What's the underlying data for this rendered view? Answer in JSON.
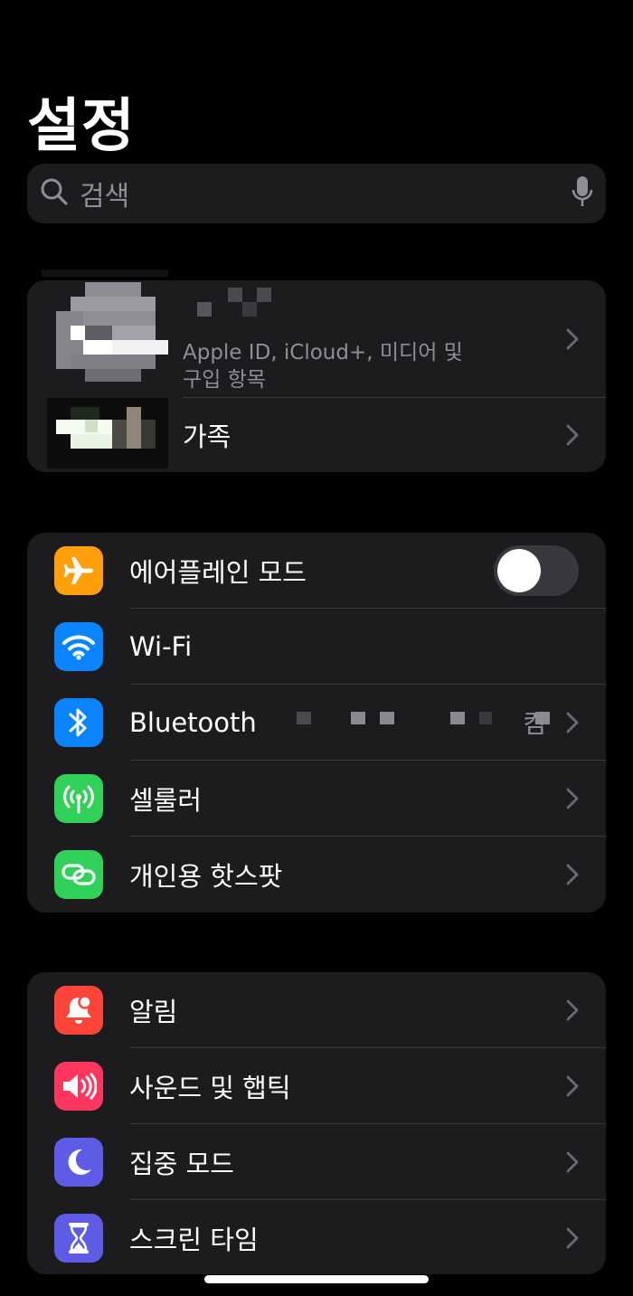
{
  "title": "설정",
  "search": {
    "placeholder": "검색",
    "icon": "search-icon",
    "mic_icon": "microphone-icon"
  },
  "account": {
    "name": "",
    "subtitle_line1": "Apple ID, iCloud+, 미디어 및",
    "subtitle_line2": "구입 항목",
    "family_label": "가족"
  },
  "connectivity": [
    {
      "key": "airplane",
      "label": "에어플레인 모드",
      "icon": "airplane-icon",
      "color": "#ff9f0a",
      "toggle": false
    },
    {
      "key": "wifi",
      "label": "Wi-Fi",
      "icon": "wifi-icon",
      "color": "#0a84ff",
      "value": ""
    },
    {
      "key": "bluetooth",
      "label": "Bluetooth",
      "icon": "bluetooth-icon",
      "color": "#0a84ff",
      "value": "켬"
    },
    {
      "key": "cellular",
      "label": "셀룰러",
      "icon": "cellular-antenna-icon",
      "color": "#30d158"
    },
    {
      "key": "hotspot",
      "label": "개인용 핫스팟",
      "icon": "hotspot-link-icon",
      "color": "#30d158"
    }
  ],
  "general": [
    {
      "key": "notifications",
      "label": "알림",
      "icon": "bell-icon",
      "color": "#ff453a"
    },
    {
      "key": "sounds",
      "label": "사운드 및 햅틱",
      "icon": "speaker-icon",
      "color": "#ff375f"
    },
    {
      "key": "focus",
      "label": "집중 모드",
      "icon": "moon-icon",
      "color": "#5e5ce6"
    },
    {
      "key": "screentime",
      "label": "스크린 타임",
      "icon": "hourglass-icon",
      "color": "#5e5ce6"
    }
  ]
}
